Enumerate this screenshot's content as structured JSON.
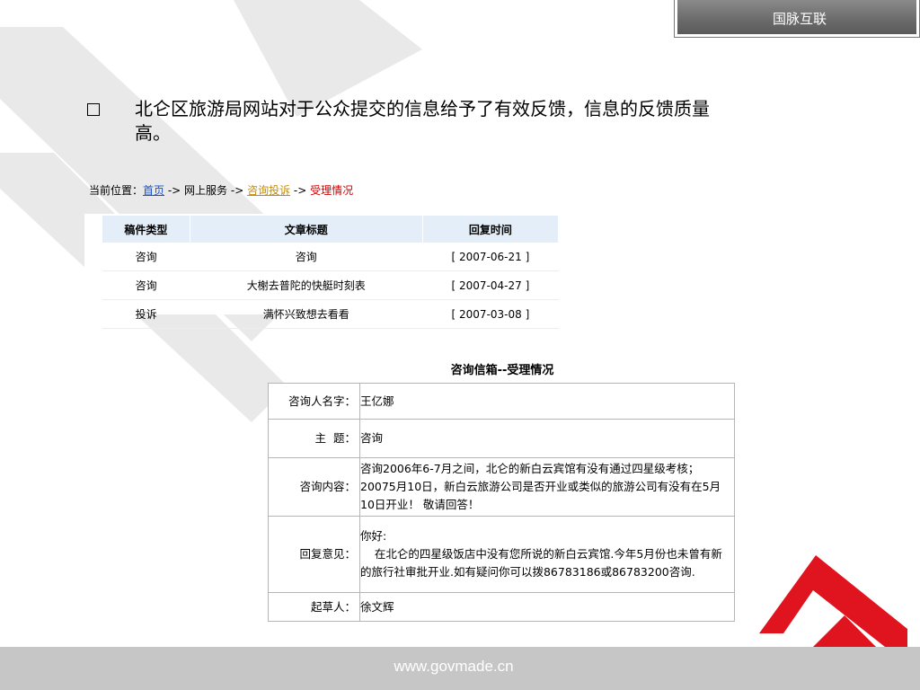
{
  "brand": {
    "name": "国脉互联"
  },
  "headline": "北仑区旅游局网站对于公众提交的信息给予了有效反馈，信息的反馈质量高。",
  "breadcrumb": {
    "prefix": "当前位置：",
    "home": "首页",
    "sep1": " -> ",
    "service": "网上服务",
    "sep2": " -> ",
    "complaint": "咨询投诉",
    "sep3": " -> ",
    "current": "受理情况"
  },
  "list": {
    "headers": [
      "稿件类型",
      "文章标题",
      "回复时间"
    ],
    "rows": [
      [
        "咨询",
        "咨询",
        "[ 2007-06-21 ]"
      ],
      [
        "咨询",
        "大榭去普陀的快艇时刻表",
        "[ 2007-04-27 ]"
      ],
      [
        "投诉",
        "满怀兴致想去看看",
        "[ 2007-03-08 ]"
      ]
    ]
  },
  "detail": {
    "title": "咨询信箱--受理情况",
    "rows": [
      {
        "label": "咨询人名字：",
        "value": "王亿娜"
      },
      {
        "label": "主  题：",
        "value": "咨询"
      },
      {
        "label": "咨询内容：",
        "value": "咨询2006年6-7月之间，北仑的新白云宾馆有没有通过四星级考核；20075月10日，新白云旅游公司是否开业或类似的旅游公司有没有在5月10日开业！  敬请回答！"
      },
      {
        "label": "回复意见：",
        "value": "你好:\n    在北仑的四星级饭店中没有您所说的新白云宾馆.今年5月份也未曾有新的旅行社审批开业.如有疑问你可以拨86783186或86783200咨询."
      },
      {
        "label": "起草人：",
        "value": "徐文辉"
      }
    ]
  },
  "footer": {
    "url": "www.govmade.cn"
  },
  "colors": {
    "decor_red": "#e0141e",
    "decor_gray": "#e6e6e6",
    "footer_bg": "#c6c6c6",
    "brand_bar": "#6e6e6e"
  }
}
